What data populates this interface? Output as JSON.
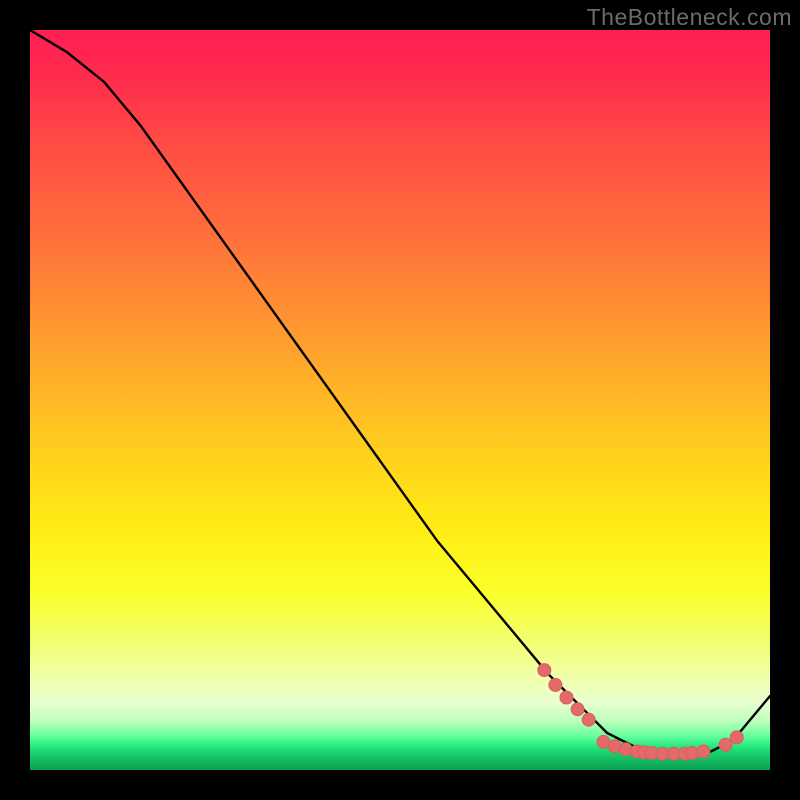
{
  "watermark": "TheBottleneck.com",
  "colors": {
    "background": "#000000",
    "curve_stroke": "#000000",
    "marker_fill": "#e46a6a",
    "marker_stroke": "#d85e5e",
    "gradient_top": "#ff1f53",
    "gradient_bottom": "#0aa052"
  },
  "chart_data": {
    "type": "line",
    "title": "",
    "xlabel": "",
    "ylabel": "",
    "xlim": [
      0,
      100
    ],
    "ylim": [
      0,
      100
    ],
    "series": [
      {
        "name": "curve",
        "x": [
          0,
          5,
          10,
          15,
          20,
          25,
          30,
          35,
          40,
          45,
          50,
          55,
          60,
          65,
          70,
          72,
          75,
          78,
          80,
          82,
          85,
          88,
          90,
          92,
          95,
          100
        ],
        "y": [
          100,
          97,
          93,
          87,
          80,
          73,
          66,
          59,
          52,
          45,
          38,
          31,
          25,
          19,
          13,
          11,
          8,
          5,
          4,
          3,
          2.5,
          2.2,
          2.2,
          2.5,
          4,
          10
        ]
      }
    ],
    "markers": [
      {
        "x": 69.5,
        "y": 13.5
      },
      {
        "x": 71.0,
        "y": 11.5
      },
      {
        "x": 72.5,
        "y": 9.8
      },
      {
        "x": 74.0,
        "y": 8.2
      },
      {
        "x": 75.5,
        "y": 6.8
      },
      {
        "x": 77.5,
        "y": 3.8
      },
      {
        "x": 79.0,
        "y": 3.2
      },
      {
        "x": 80.5,
        "y": 2.8
      },
      {
        "x": 82.0,
        "y": 2.5
      },
      {
        "x": 83.0,
        "y": 2.4
      },
      {
        "x": 84.0,
        "y": 2.3
      },
      {
        "x": 85.5,
        "y": 2.2
      },
      {
        "x": 87.0,
        "y": 2.2
      },
      {
        "x": 88.5,
        "y": 2.2
      },
      {
        "x": 89.5,
        "y": 2.3
      },
      {
        "x": 91.0,
        "y": 2.5
      },
      {
        "x": 94.0,
        "y": 3.4
      },
      {
        "x": 95.5,
        "y": 4.4
      }
    ],
    "notes": "Black curve descends steeply from upper-left, flattens to a minimum around x≈85–90 near the green band, then rises toward the right edge. Salmon-pink dotted markers cluster along the valley."
  }
}
